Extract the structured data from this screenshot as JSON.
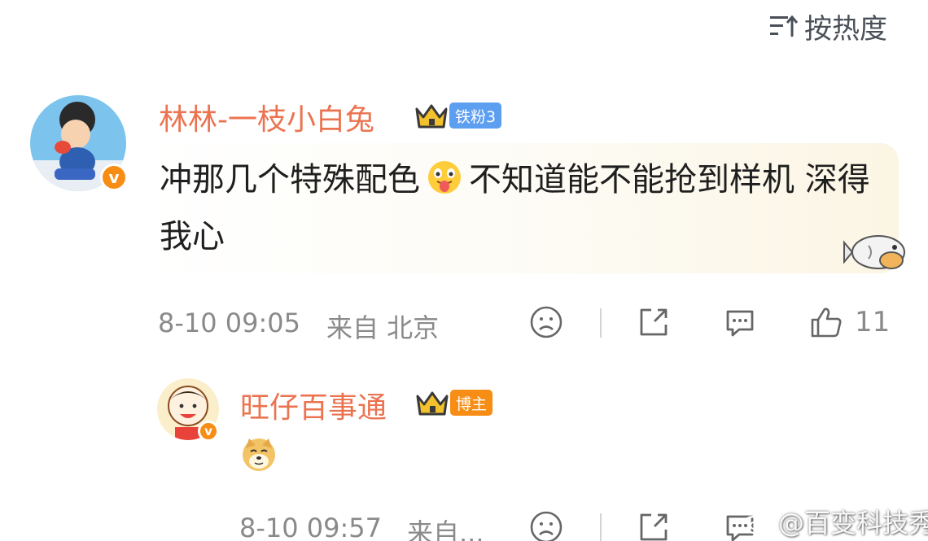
{
  "sort": {
    "label": "按热度",
    "icon": "sort-icon"
  },
  "comments": [
    {
      "author": "林林-一枝小白兔",
      "fan_badge": "铁粉3",
      "text_part1": "冲那几个特殊配色",
      "text_part2": "不知道能不能抢到样机 深得我心",
      "inline_emoji": "tongue-out-emoji",
      "time": "8-10 09:05",
      "location": "来自 北京",
      "like_count": "11"
    },
    {
      "author": "旺仔百事通",
      "fan_badge": "博主",
      "emoji": "doge-emoji",
      "time": "8-10 09:57",
      "location": "来自..."
    }
  ],
  "watermark": {
    "text": "@百变科技秀"
  },
  "colors": {
    "username": "#eb7350",
    "meta": "#8a8a8a",
    "fan_blue": "#5c9ef0",
    "fan_orange": "#f78d14",
    "verified": "#f78d14"
  }
}
